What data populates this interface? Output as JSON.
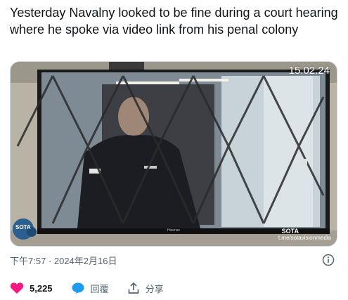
{
  "tweet": {
    "text": "Yesterday Navalny looked to be fine during a court hearing where he spoke via video link from his penal colony"
  },
  "media": {
    "timestamp_overlay": "15.02.24",
    "logo_text": "SOTA",
    "tv_brand": "Hisense",
    "watermark_title": "SOTA",
    "watermark_url": "t.me/sotavisionmedia"
  },
  "meta": {
    "timestamp": "下午7:57 · 2024年2月16日"
  },
  "actions": {
    "like_count": "5,225",
    "reply_label": "回覆",
    "share_label": "分享"
  },
  "colors": {
    "like": "#f91880",
    "reply": "#1d9bf0",
    "muted": "#536471"
  }
}
